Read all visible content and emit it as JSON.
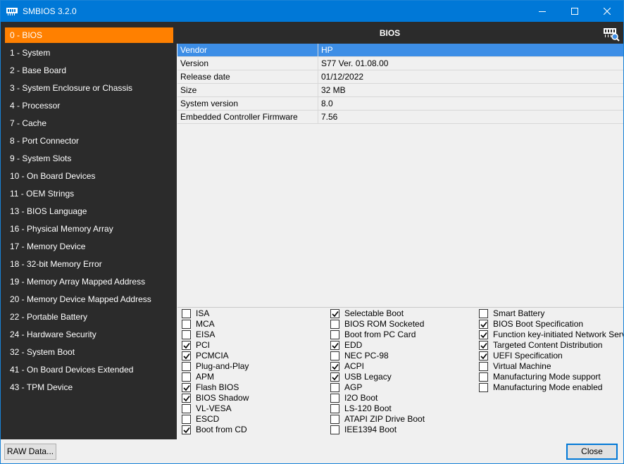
{
  "window": {
    "title": "SMBIOS 3.2.0",
    "accent_color": "#0078d7",
    "selection_color": "#ff8000"
  },
  "sidebar": {
    "items": [
      {
        "label": "0 - BIOS",
        "selected": true
      },
      {
        "label": "1 - System"
      },
      {
        "label": "2 - Base Board"
      },
      {
        "label": "3 - System Enclosure or Chassis"
      },
      {
        "label": "4 - Processor"
      },
      {
        "label": "7 - Cache"
      },
      {
        "label": "8 - Port Connector"
      },
      {
        "label": "9 - System Slots"
      },
      {
        "label": "10 - On Board Devices"
      },
      {
        "label": "11 - OEM Strings"
      },
      {
        "label": "13 - BIOS Language"
      },
      {
        "label": "16 - Physical Memory Array"
      },
      {
        "label": "17 - Memory Device"
      },
      {
        "label": "18 - 32-bit Memory Error"
      },
      {
        "label": "19 - Memory Array Mapped Address"
      },
      {
        "label": "20 - Memory Device Mapped Address"
      },
      {
        "label": "22 - Portable Battery"
      },
      {
        "label": "24 - Hardware Security"
      },
      {
        "label": "32 - System Boot"
      },
      {
        "label": "41 - On Board Devices Extended"
      },
      {
        "label": "43 - TPM Device"
      }
    ]
  },
  "main": {
    "title": "BIOS",
    "header_icon": "chip-search-icon",
    "properties": [
      {
        "name": "Vendor",
        "value": "HP",
        "selected": true
      },
      {
        "name": "Version",
        "value": "S77 Ver. 01.08.00"
      },
      {
        "name": "Release date",
        "value": "01/12/2022"
      },
      {
        "name": "Size",
        "value": "32 MB"
      },
      {
        "name": "System version",
        "value": "8.0"
      },
      {
        "name": "Embedded Controller Firmware",
        "value": "7.56"
      }
    ],
    "flags": [
      [
        {
          "label": "ISA",
          "checked": false
        },
        {
          "label": "MCA",
          "checked": false
        },
        {
          "label": "EISA",
          "checked": false
        },
        {
          "label": "PCI",
          "checked": true
        },
        {
          "label": "PCMCIA",
          "checked": true
        },
        {
          "label": "Plug-and-Play",
          "checked": false
        },
        {
          "label": "APM",
          "checked": false
        },
        {
          "label": "Flash BIOS",
          "checked": true
        },
        {
          "label": "BIOS Shadow",
          "checked": true
        },
        {
          "label": "VL-VESA",
          "checked": false
        },
        {
          "label": "ESCD",
          "checked": false
        },
        {
          "label": "Boot from CD",
          "checked": true
        }
      ],
      [
        {
          "label": "Selectable Boot",
          "checked": true
        },
        {
          "label": "BIOS ROM Socketed",
          "checked": false
        },
        {
          "label": "Boot from PC Card",
          "checked": false
        },
        {
          "label": "EDD",
          "checked": true
        },
        {
          "label": "NEC PC-98",
          "checked": false
        },
        {
          "label": "ACPI",
          "checked": true
        },
        {
          "label": "USB Legacy",
          "checked": true
        },
        {
          "label": "AGP",
          "checked": false
        },
        {
          "label": "I2O Boot",
          "checked": false
        },
        {
          "label": "LS-120 Boot",
          "checked": false
        },
        {
          "label": "ATAPI ZIP Drive Boot",
          "checked": false
        },
        {
          "label": "IEE1394 Boot",
          "checked": false
        }
      ],
      [
        {
          "label": "Smart Battery",
          "checked": false
        },
        {
          "label": "BIOS Boot Specification",
          "checked": true
        },
        {
          "label": "Function key-initiated Network Service Boot",
          "checked": true
        },
        {
          "label": "Targeted Content Distribution",
          "checked": true
        },
        {
          "label": "UEFI Specification",
          "checked": true
        },
        {
          "label": "Virtual Machine",
          "checked": false
        },
        {
          "label": "Manufacturing Mode support",
          "checked": false
        },
        {
          "label": "Manufacturing Mode enabled",
          "checked": false
        }
      ]
    ]
  },
  "footer": {
    "raw_label": "RAW Data...",
    "close_label": "Close"
  }
}
